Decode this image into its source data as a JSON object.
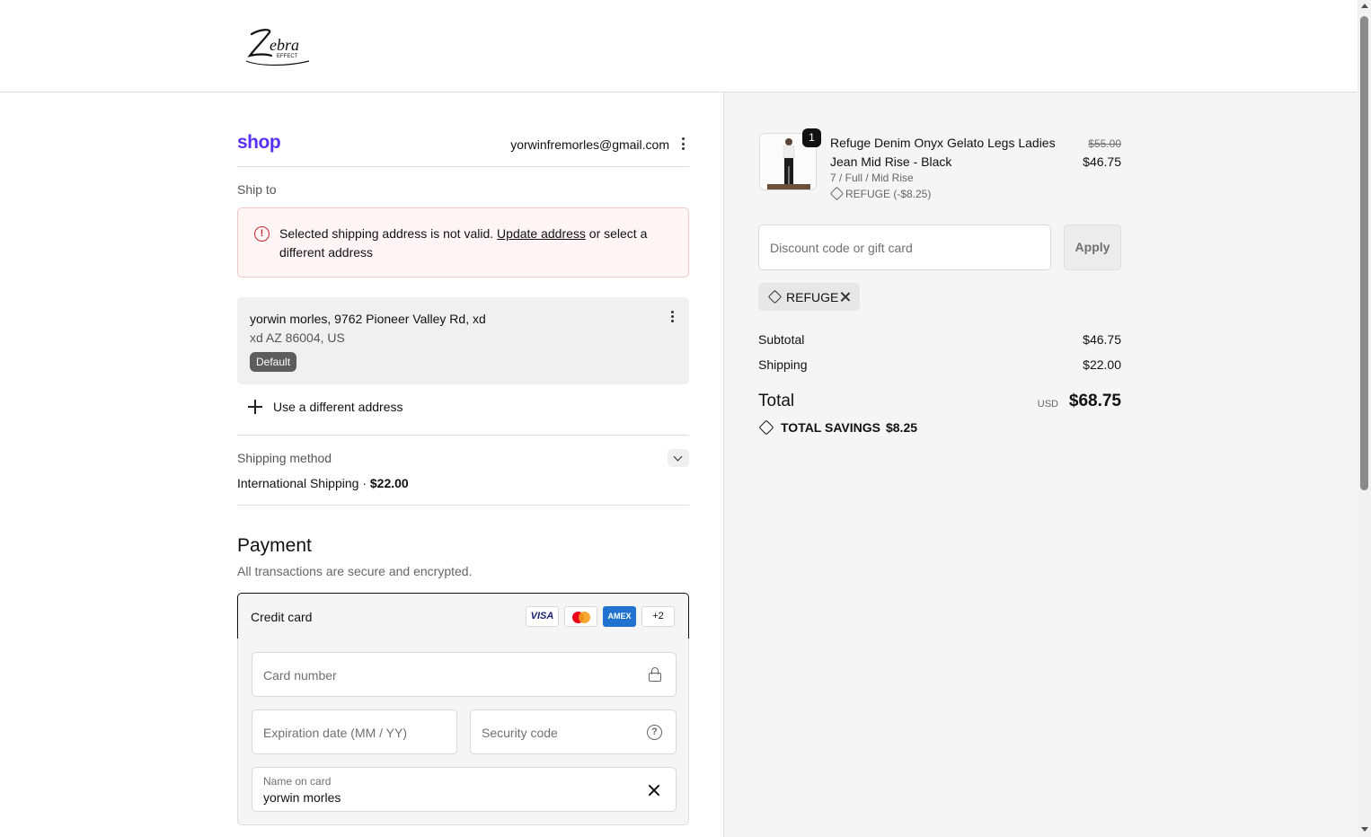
{
  "header": {
    "logo_alt": "Zebra Effect"
  },
  "account": {
    "brand": "shop",
    "email": "yorwinfremorles@gmail.com"
  },
  "shipping": {
    "ship_to_label": "Ship to",
    "error": {
      "before_link": "Selected shipping address is not valid. ",
      "link": "Update address",
      "after_link": " or select a different address"
    },
    "address": {
      "line1": "yorwin morles, 9762 Pioneer Valley Rd, xd",
      "line2": "xd AZ 86004, US",
      "badge": "Default"
    },
    "use_different": "Use a different address",
    "method_label": "Shipping method",
    "method_name": "International Shipping · ",
    "method_price": "$22.00"
  },
  "payment": {
    "title": "Payment",
    "subtitle": "All transactions are secure and encrypted.",
    "option_label": "Credit card",
    "brands": [
      "VISA",
      "MC",
      "AMEX",
      "+2"
    ],
    "card_number_placeholder": "Card number",
    "expiry_placeholder": "Expiration date (MM / YY)",
    "security_placeholder": "Security code",
    "name_label": "Name on card",
    "name_value": "yorwin morles"
  },
  "summary": {
    "item": {
      "qty": "1",
      "name": "Refuge Denim Onyx Gelato Legs Ladies Jean Mid Rise - Black",
      "variant": "7 / Full / Mid Rise",
      "discount": "REFUGE (-$8.25)",
      "price_old": "$55.00",
      "price_new": "$46.75"
    },
    "discount_placeholder": "Discount code or gift card",
    "apply_label": "Apply",
    "applied_code": "REFUGE",
    "subtotal_label": "Subtotal",
    "subtotal_value": "$46.75",
    "shipping_label": "Shipping",
    "shipping_value": "$22.00",
    "total_label": "Total",
    "currency": "USD",
    "total_value": "$68.75",
    "savings_label": "TOTAL SAVINGS",
    "savings_value": "$8.25"
  },
  "colors": {
    "shop_purple": "#5a31f4",
    "error_red": "#c8242f",
    "amex_blue": "#1f72cd"
  }
}
